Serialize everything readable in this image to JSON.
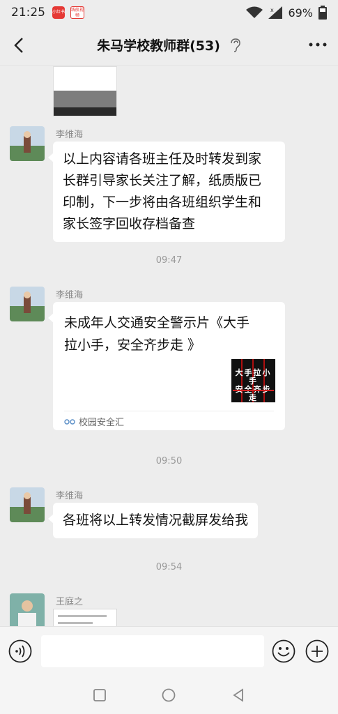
{
  "status_bar": {
    "time": "21:25",
    "app_badge_1": "小红书",
    "app_badge_2": "线航视频",
    "battery": "69%"
  },
  "header": {
    "title": "朱马学校教师群(53)"
  },
  "messages": [
    {
      "sender": "李维海",
      "text_lines": [
        "以上内容请各班主任及时转发到家",
        "长群引导家长关注了解，纸质版已",
        "印制，下一步将由各班组织学生和",
        "家长签字回收存档备查"
      ]
    },
    {
      "sender": "李维海",
      "card": {
        "title_lines": [
          "未成年人交通安全警示片《大手",
          "拉小手，安全齐步走 》"
        ],
        "thumb_text": [
          "大手拉小手",
          "安全齐步走"
        ],
        "source": "校园安全汇"
      }
    },
    {
      "sender": "李维海",
      "text": "各班将以上转发情况截屏发给我"
    },
    {
      "sender": "王庭之"
    }
  ],
  "timestamps": [
    "09:47",
    "09:50",
    "09:54"
  ],
  "icons": {
    "back": "back-arrow-icon",
    "ear": "ear-icon",
    "more": "more-dots-icon",
    "voice": "voice-icon",
    "emoji": "emoji-icon",
    "plus": "plus-icon",
    "nav_recent": "recent-apps-icon",
    "nav_home": "home-icon",
    "nav_back": "nav-back-icon"
  },
  "colors": {
    "chat_background": "#ededed",
    "bubble": "#ffffff",
    "muted_text": "#999999"
  }
}
